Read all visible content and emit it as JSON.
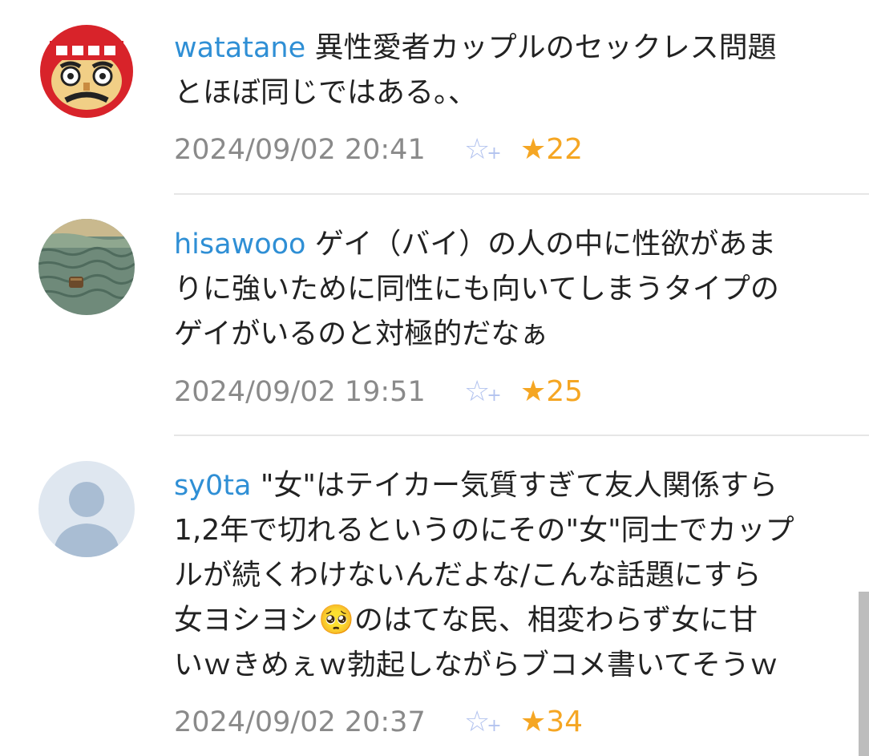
{
  "comments": [
    {
      "user": "watatane",
      "text_lines": [
        "異性愛者カップルのセックレス問題",
        "とほぼ同じではある。、"
      ],
      "timestamp": "2024/09/02 20:41",
      "add_star_icon": "☆",
      "add_star_plus": "+",
      "star_label": "★22",
      "avatar_icon": "daruma-avatar"
    },
    {
      "user": "hisawooo",
      "text_lines": [
        "ゲイ（バイ）の人の中に性欲があま",
        "りに強いために同性にも向いてしまうタイプの",
        "ゲイがいるのと対極的だなぁ"
      ],
      "timestamp": "2024/09/02 19:51",
      "add_star_icon": "☆",
      "add_star_plus": "+",
      "star_label": "★25",
      "avatar_icon": "sea-painting-avatar"
    },
    {
      "user": "sy0ta",
      "text_lines": [
        "\"女\"はテイカー気質すぎて友人関係すら",
        "1,2年で切れるというのにその\"女\"同士でカップ",
        "ルが続くわけないんだよな/こんな話題にすら",
        "女ヨシヨシ🥺のはてな民、相変わらず女に甘",
        "いｗきめぇｗ勃起しながらブコメ書いてそうｗ"
      ],
      "timestamp": "2024/09/02 20:37",
      "add_star_icon": "☆",
      "add_star_plus": "+",
      "star_label": "★34",
      "avatar_icon": "default-user-avatar"
    }
  ],
  "colors": {
    "username": "#2f8fd5",
    "star": "#f5a623",
    "add_star": "#b3c3ef",
    "timestamp": "#8a8a8a"
  }
}
